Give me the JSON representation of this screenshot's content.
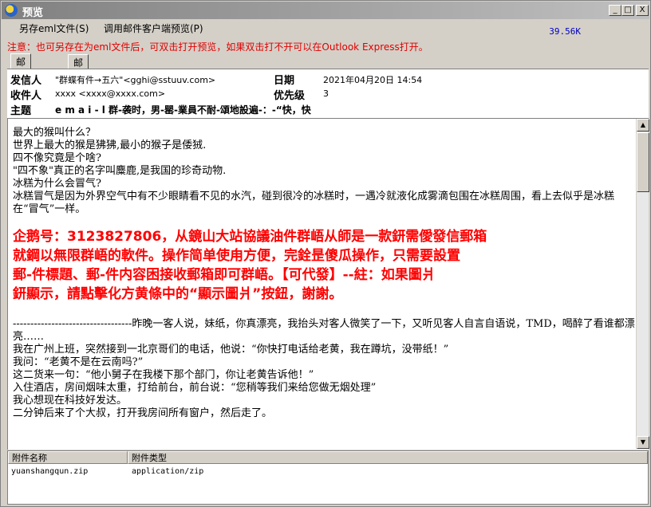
{
  "window": {
    "title": "预览",
    "minimize": "_",
    "maximize": "□",
    "close": "X"
  },
  "menu": {
    "save_eml": "另存eml文件(S)",
    "open_client": "调用邮件客户端预览(P)",
    "size": "39.56K"
  },
  "notice": "注意：也可另存在为eml文件后，可双击打开预览，如果双击打不开可以在Outlook Express打开。",
  "tabs": [
    "邮件内容",
    "邮件来源"
  ],
  "header": {
    "from_label": "发信人",
    "from_value": "\"群蝶有件→五六\"<gghi@sstuuv.com>",
    "date_label": "日期",
    "date_value": "2021年04月20日 14:54",
    "to_label": "收件人",
    "to_value": "xxxx <xxxx@xxxx.com>",
    "priority_label": "优先级",
    "priority_value": "3",
    "subject_label": "主题",
    "subject_value": "e m a i - l 群-袭时，男-罂-業員不耐-頌地設遍-：-“快，快"
  },
  "body": {
    "lines_top": [
      "最大的猴叫什么？",
      "世界上最大的猴是狒狒,最小的猴子是倭狨.",
      "四不像究竟是个啥?",
      "\"四不象\"真正的名字叫麋鹿,是我国的珍奇动物.",
      "冰糕为什么会冒气?",
      "冰糕冒气是因为外界空气中有不少眼睛看不见的水汽，碰到很冷的冰糕时，一遇冷就液化成雾滴包围在冰糕周围，看上去似乎是冰糕在“冒气”一样。"
    ],
    "ad": [
      "企鹅号：3123827806，从鏡山大站協議油件群峿从師是一款鈃需僾發信郵箱",
      "就鋼以無限群峿的軟件。操作简单使甪方便，完銓昰傻瓜操作，只需要設置",
      "郵-件標題、郵-件内容困接收郵箱即可群峿。【可代發】--紸：如果圖爿",
      "鈃顯示，請點擊化方黄條中的“顯示圖爿”按鈕，謝謝。"
    ],
    "lines_bottom": [
      "----------------------------------昨晚一客人说，妹纸，你真漂亮，我抬头对客人微笑了一下，又听见客人自言自语说，TMD，喝醉了看谁都漂亮……",
      "我在广州上班，突然接到一北京哥们的电话，他说：“你快打电话给老黄，我在蹲坑，没带纸！”",
      "我问：“老黄不是在云南吗?”",
      "这二货来一句：“他小舅子在我楼下那个部门，你让老黄告诉他！”",
      "入住酒店，房间烟味太重，打给前台，前台说：“您稍等我们来给您做无烟处理”",
      "我心想现在科技好发达。",
      "二分钟后来了个大叔，打开我房间所有窗户，然后走了。"
    ]
  },
  "attachments": {
    "col_name": "附件名称",
    "col_type": "附件类型",
    "rows": [
      {
        "name": "yuanshangqun.zip",
        "type": "application/zip"
      }
    ]
  },
  "icons": {
    "app": "outlook-preview-icon",
    "up": "scroll-up-icon",
    "down": "scroll-down-icon"
  }
}
